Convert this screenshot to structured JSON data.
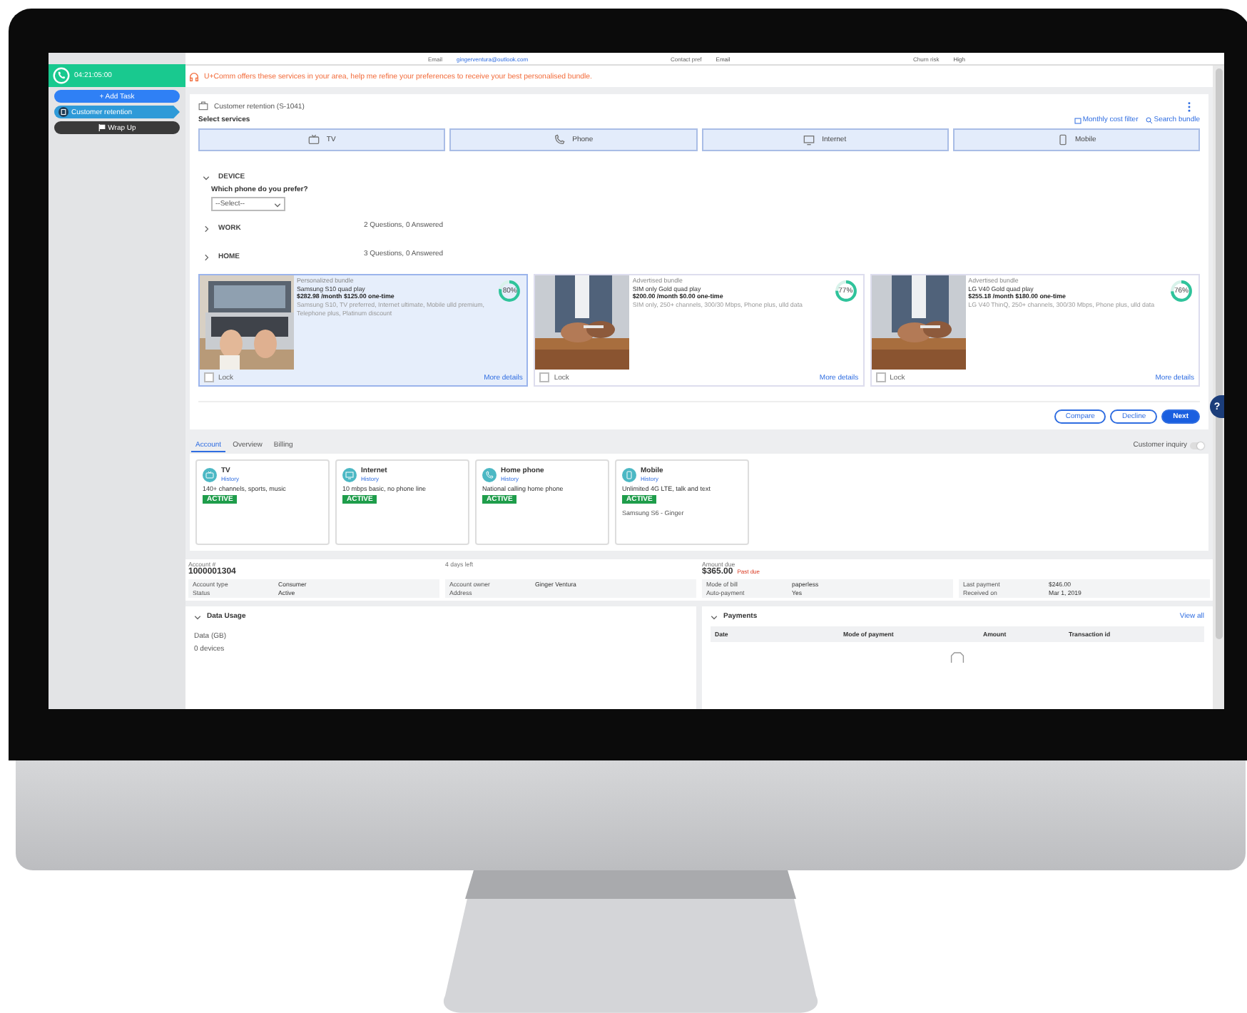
{
  "top_strip": [
    {
      "label": "Email",
      "value": "gingerventura@outlook.com"
    },
    {
      "label": "Contact pref",
      "value": "Email"
    },
    {
      "label": "Churn risk",
      "value": "High"
    }
  ],
  "sidebar": {
    "timer": "04:21:05:00",
    "buttons": [
      {
        "label": "+ Add Task",
        "kind": "add"
      },
      {
        "label": "Customer retention",
        "kind": "case"
      },
      {
        "label": "Wrap Up",
        "kind": "wrap"
      }
    ]
  },
  "banner": "U+Comm offers these services in your area, help me refine your preferences to receive your best personalised bundle.",
  "case": {
    "title": "Customer retention (S-1041)",
    "select_label": "Select services",
    "links": [
      "Monthly cost filter",
      "Search bundle"
    ],
    "services": [
      {
        "label": "TV",
        "kind": "tv"
      },
      {
        "label": "Phone",
        "kind": "phone"
      },
      {
        "label": "Internet",
        "kind": "internet"
      },
      {
        "label": "Mobile",
        "kind": "mobile"
      }
    ],
    "sections": [
      {
        "title": "DEVICE",
        "expanded": true,
        "question": "Which phone do you prefer?",
        "placeholder": "--Select--"
      },
      {
        "title": "WORK",
        "expanded": false,
        "summary": "2 Questions, 0 Answered"
      },
      {
        "title": "HOME",
        "expanded": false,
        "summary": "3 Questions, 0 Answered"
      }
    ],
    "bundles": [
      {
        "kind_label": "Personalized bundle",
        "title": "Samsung S10 quad play",
        "price": "$282.98 /month  $125.00 one-time",
        "description": "Samsung S10, TV preferred, Internet ultimate, Mobile ulld premium, Telephone plus, Platinum discount",
        "reading": "80%",
        "level": 0.8,
        "selected": true,
        "lock": "Lock",
        "locked": false,
        "link": "More details"
      },
      {
        "kind_label": "Advertised bundle",
        "title": "SIM only Gold quad play",
        "price": "$200.00 /month  $0.00 one-time",
        "description": "SIM only, 250+ channels, 300/30 Mbps, Phone plus, ulld data",
        "reading": "77%",
        "level": 0.77,
        "selected": false,
        "lock": "Lock",
        "locked": false,
        "link": "More details"
      },
      {
        "kind_label": "Advertised bundle",
        "title": "LG V40 Gold quad play",
        "price": "$255.18 /month  $180.00 one-time",
        "description": "LG V40 ThinQ, 250+ channels, 300/30 Mbps, Phone plus, ulld data",
        "reading": "76%",
        "level": 0.76,
        "selected": false,
        "lock": "Lock",
        "locked": false,
        "link": "More details"
      }
    ],
    "actions": [
      {
        "label": "Compare",
        "kind": "outline"
      },
      {
        "label": "Decline",
        "kind": "outline"
      },
      {
        "label": "Next",
        "kind": "primary"
      }
    ]
  },
  "account_tabs": [
    {
      "label": "Account",
      "selected": true
    },
    {
      "label": "Overview",
      "selected": false
    },
    {
      "label": "Billing",
      "selected": false
    }
  ],
  "inquiry": {
    "label": "Customer inquiry",
    "on": false
  },
  "products": [
    {
      "name": "TV",
      "kind": "tv",
      "link": "History",
      "description": "140+ channels, sports, music",
      "status": "ACTIVE"
    },
    {
      "name": "Internet",
      "kind": "internet",
      "link": "History",
      "description": "10 mbps basic, no phone line",
      "status": "ACTIVE"
    },
    {
      "name": "Home phone",
      "kind": "phone",
      "link": "History",
      "description": "National calling home phone",
      "status": "ACTIVE"
    },
    {
      "name": "Mobile",
      "kind": "mobile",
      "link": "History",
      "description": "Unlimited 4G LTE, talk and text",
      "status": "ACTIVE",
      "device": "Samsung S6  -  Ginger"
    }
  ],
  "account": {
    "number_label": "Account #",
    "number": "1000001304",
    "days_left": "4 days left",
    "amount_label": "Amount due",
    "amount": "$365.00",
    "amount_status": "Past due",
    "details": [
      [
        {
          "label": "Account type",
          "value": "Consumer"
        },
        {
          "label": "Status",
          "value": "Active"
        }
      ],
      [
        {
          "label": "Account owner",
          "value": "Ginger Ventura"
        },
        {
          "label": "Address"
        }
      ],
      [
        {
          "label": "Mode of bill",
          "value": "paperless"
        },
        {
          "label": "Auto-payment",
          "value": "Yes"
        }
      ],
      [
        {
          "label": "Last payment",
          "value": "$246.00"
        },
        {
          "label": "Received on",
          "value": "Mar 1, 2019"
        }
      ]
    ]
  },
  "data_usage": {
    "title": "Data Usage",
    "lines": [
      "Data (GB)",
      "0 devices"
    ]
  },
  "payments": {
    "title": "Payments",
    "link": "View all",
    "columns": [
      "Date",
      "Mode of payment",
      "Amount",
      "Transaction id"
    ]
  },
  "help": "?"
}
